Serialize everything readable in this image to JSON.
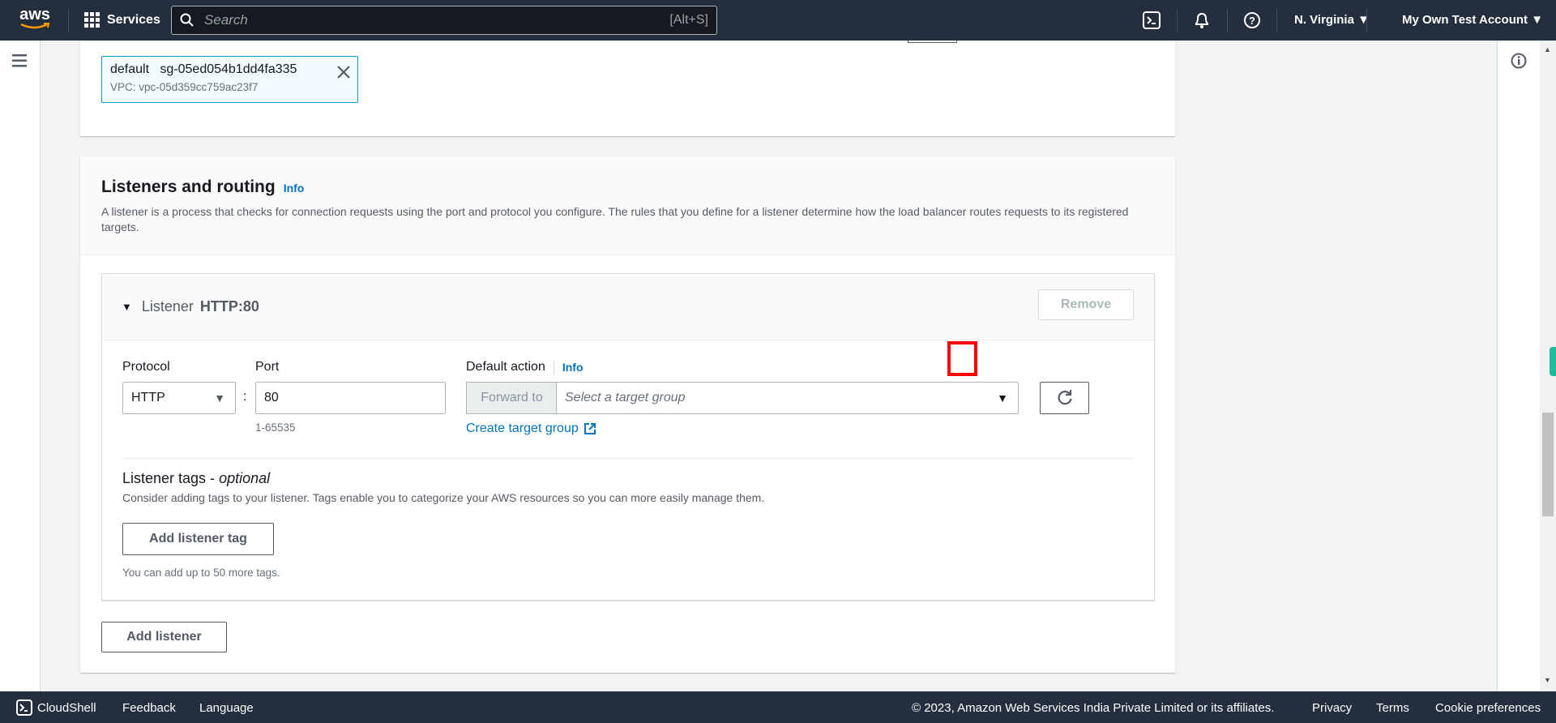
{
  "nav": {
    "logo": "aws",
    "services": "Services",
    "search_placeholder": "Search",
    "search_shortcut": "[Alt+S]",
    "region": "N. Virginia",
    "account": "My Own Test Account"
  },
  "security_group": {
    "name": "default",
    "id": "sg-05ed054b1dd4fa335",
    "vpc": "VPC: vpc-05d359cc759ac23f7"
  },
  "listeners": {
    "title": "Listeners and routing",
    "info": "Info",
    "description": "A listener is a process that checks for connection requests using the port and protocol you configure. The rules that you define for a listener determine how the load balancer routes requests to its registered targets.",
    "listener": {
      "label": "Listener",
      "name": "HTTP:80",
      "remove": "Remove",
      "protocol_label": "Protocol",
      "protocol_value": "HTTP",
      "port_label": "Port",
      "port_value": "80",
      "port_hint": "1-65535",
      "colon": ":",
      "default_action_label": "Default action",
      "default_action_info": "Info",
      "forward_to": "Forward to",
      "target_group_placeholder": "Select a target group",
      "create_target_group": "Create target group",
      "tags_title": "Listener tags - ",
      "tags_optional": "optional",
      "tags_description": "Consider adding tags to your listener. Tags enable you to categorize your AWS resources so you can more easily manage them.",
      "add_tag": "Add listener tag",
      "tags_hint": "You can add up to 50 more tags."
    },
    "add_listener": "Add listener"
  },
  "footer": {
    "cloudshell": "CloudShell",
    "feedback": "Feedback",
    "language": "Language",
    "copyright": "© 2023, Amazon Web Services India Private Limited or its affiliates.",
    "privacy": "Privacy",
    "terms": "Terms",
    "cookies": "Cookie preferences"
  },
  "colors": {
    "nav_bg": "#232f3e",
    "link": "#0073bb",
    "highlight": "#ff0000"
  }
}
